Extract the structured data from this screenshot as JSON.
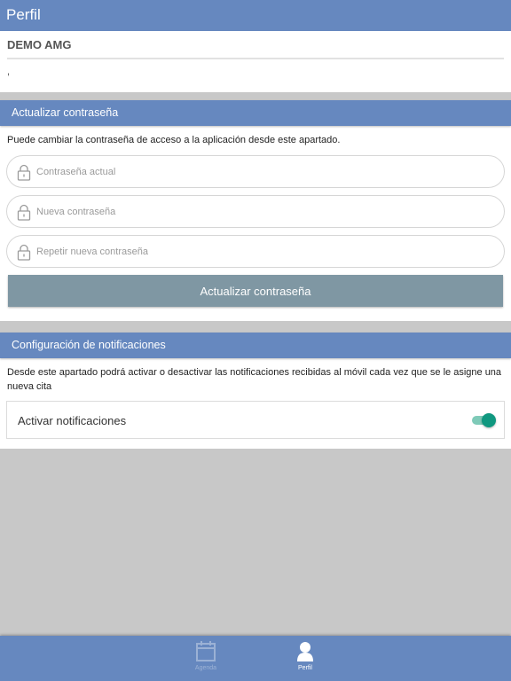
{
  "header": {
    "title": "Perfil"
  },
  "user": {
    "name": "DEMO AMG",
    "subtitle": ","
  },
  "password_section": {
    "title": "Actualizar contraseña",
    "description": "Puede cambiar la contraseña de acceso a la aplicación desde este apartado.",
    "fields": [
      {
        "placeholder": "Contraseña actual",
        "value": "",
        "icon": "lock-icon"
      },
      {
        "placeholder": "Nueva contraseña",
        "value": "",
        "icon": "lock-icon"
      },
      {
        "placeholder": "Repetir nueva contraseña",
        "value": "",
        "icon": "lock-icon"
      }
    ],
    "button_label": "Actualizar contraseña"
  },
  "notifications_section": {
    "title": "Configuración de notificaciones",
    "description": "Desde este apartado podrá activar o desactivar las notificaciones recibidas al móvil cada vez que se le asigne una nueva cita",
    "toggle_label": "Activar notificaciones",
    "toggle_on": true
  },
  "bottom_nav": {
    "items": [
      {
        "label": "Agenda",
        "icon": "calendar-icon",
        "active": false
      },
      {
        "label": "Perfil",
        "icon": "person-icon",
        "active": true
      }
    ]
  },
  "colors": {
    "primary": "#6688bf",
    "button_disabled": "#7f97a3",
    "toggle_on": "#109880",
    "background": "#c8c8c8"
  }
}
